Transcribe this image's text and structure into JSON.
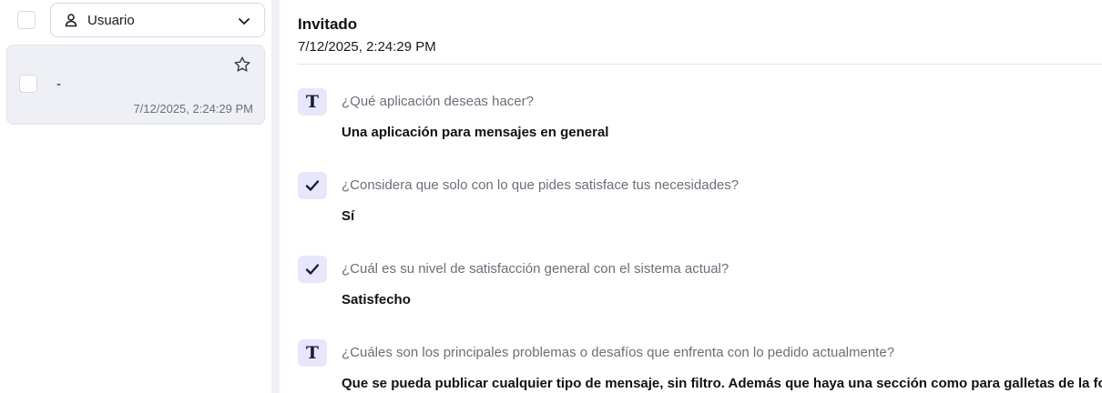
{
  "sidebar": {
    "filter": {
      "icon": "user-icon",
      "label": "Usuario",
      "chevron": "chevron-down-icon"
    },
    "conversations": [
      {
        "title": "-",
        "timestamp": "7/12/2025, 2:24:29 PM",
        "starred": false
      }
    ]
  },
  "main": {
    "user_name": "Invitado",
    "submitted_at": "7/12/2025, 2:24:29 PM",
    "qa": [
      {
        "type_icon": "text-type-icon",
        "question": "¿Qué aplicación deseas hacer?",
        "answer": "Una aplicación para mensajes en general"
      },
      {
        "type_icon": "check-icon",
        "question": "¿Considera que solo con lo que pides satisface tus necesidades?",
        "answer": "Sí"
      },
      {
        "type_icon": "check-icon",
        "question": "¿Cuál es su nivel de satisfacción general con el sistema actual?",
        "answer": "Satisfecho"
      },
      {
        "type_icon": "text-type-icon",
        "question": "¿Cuáles son los principales problemas o desafíos que enfrenta con lo pedido actualmente?",
        "answer": "Que se pueda publicar cualquier tipo de mensaje, sin filtro. Además que haya una sección como para galletas de la fortuna"
      }
    ]
  },
  "colors": {
    "icon_bg": "#e8e6fb",
    "icon_fg": "#1e1b3a",
    "card_bg": "#eef0f6",
    "muted_text": "#6b6f78"
  }
}
